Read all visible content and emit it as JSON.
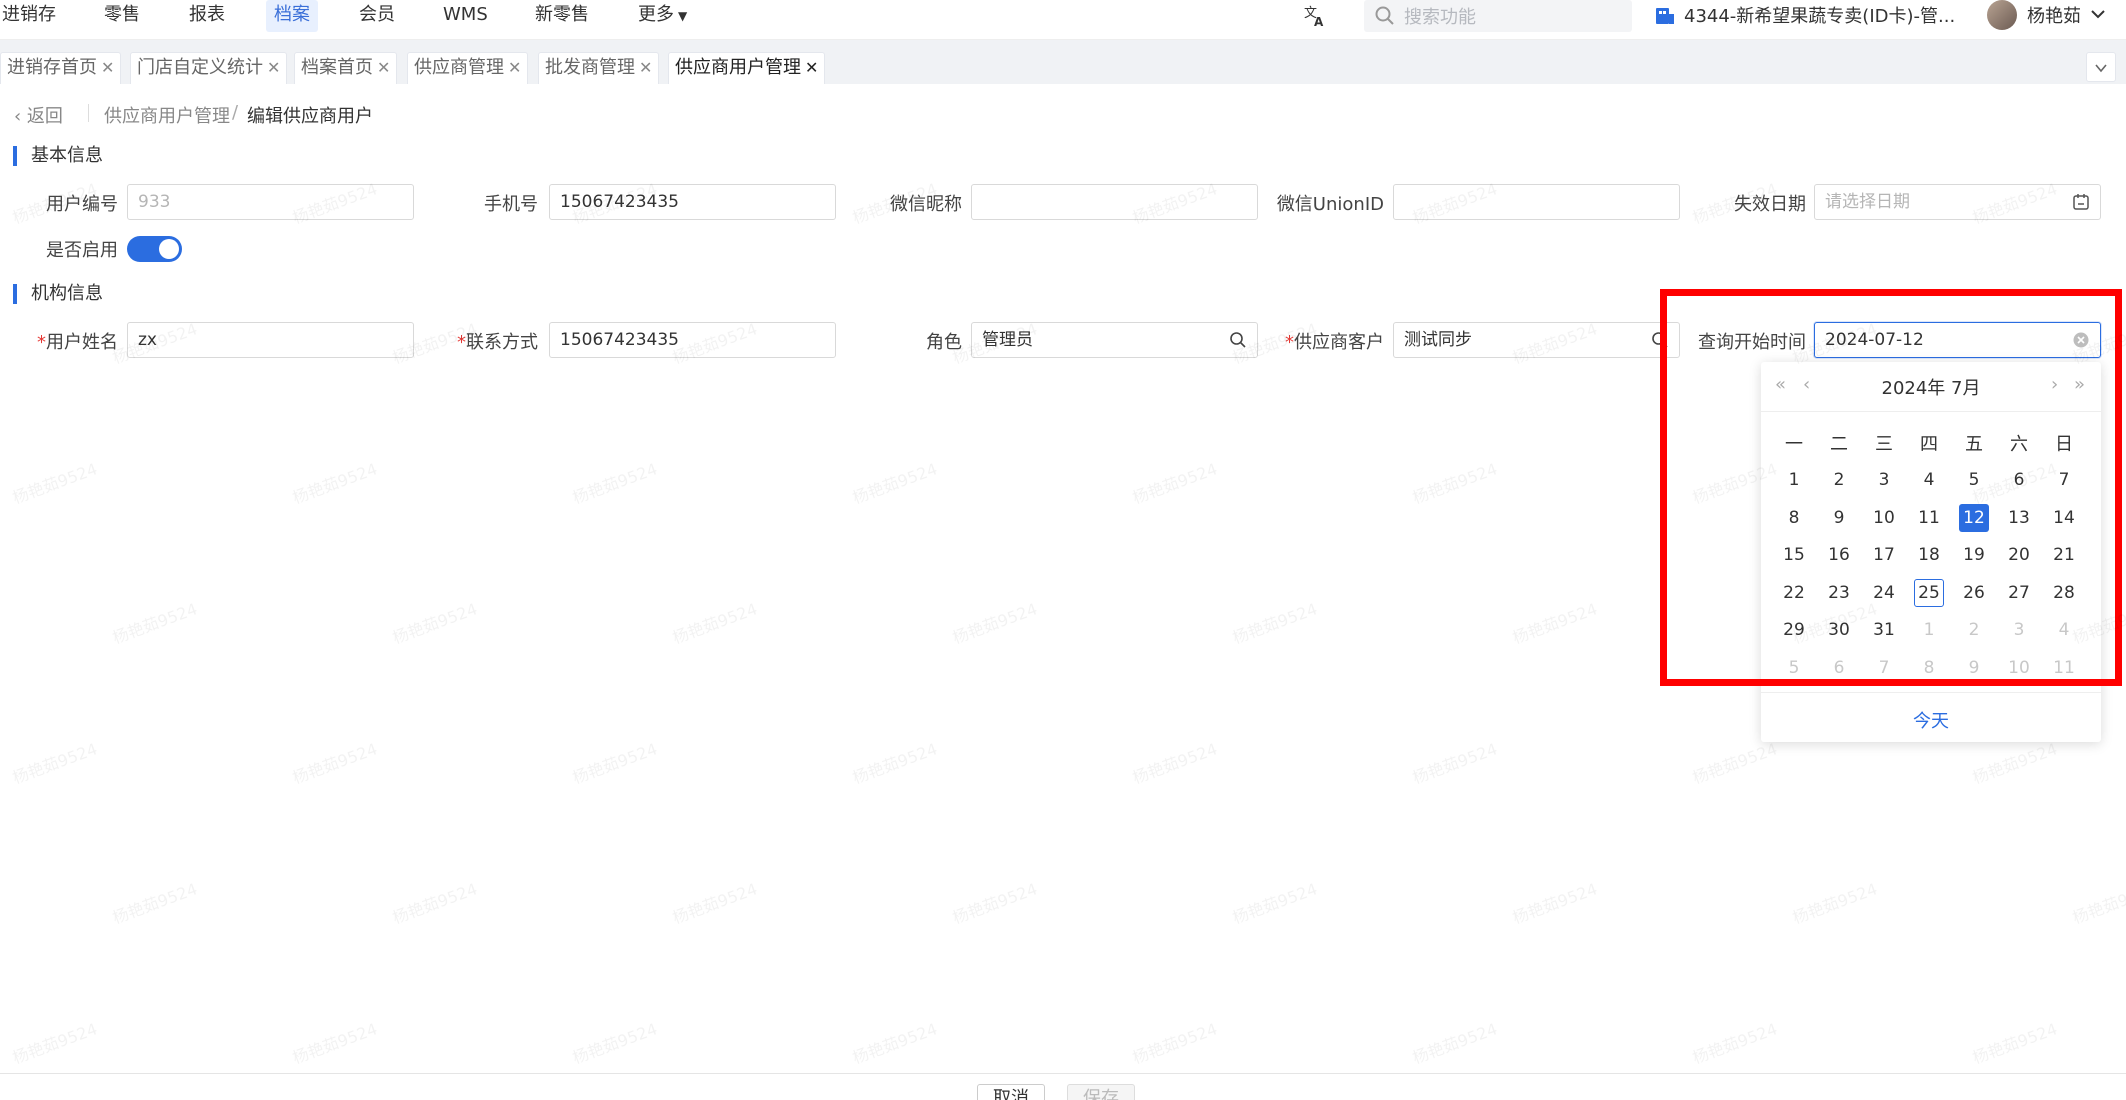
{
  "topnav": {
    "items": [
      {
        "label": "进销存"
      },
      {
        "label": "零售"
      },
      {
        "label": "报表"
      },
      {
        "label": "档案"
      },
      {
        "label": "会员"
      },
      {
        "label": "WMS"
      },
      {
        "label": "新零售"
      },
      {
        "label": "更多"
      }
    ],
    "active": "档案",
    "search_placeholder": "搜索功能",
    "store": "4344-新希望果蔬专卖(ID卡)-管...",
    "user": "杨艳茹"
  },
  "tabs": [
    {
      "label": "进销存首页"
    },
    {
      "label": "门店自定义统计"
    },
    {
      "label": "档案首页"
    },
    {
      "label": "供应商管理"
    },
    {
      "label": "批发商管理"
    },
    {
      "label": "供应商用户管理"
    }
  ],
  "breadcrumb": {
    "back": "返回",
    "parent": "供应商用户管理",
    "separator": "/",
    "current": "编辑供应商用户"
  },
  "basic": {
    "title": "基本信息",
    "user_no_label": "用户编号",
    "user_no": "933",
    "phone_label": "手机号",
    "phone": "15067423435",
    "wechat_nick_label": "微信昵称",
    "wechat_nick": "",
    "unionid_label": "微信UnionID",
    "unionid": "",
    "expire_label": "失效日期",
    "expire_placeholder": "请选择日期",
    "enabled_label": "是否启用",
    "enabled": true
  },
  "org": {
    "title": "机构信息",
    "required_mark": "*",
    "username_label": "用户姓名",
    "username": "zx",
    "contact_label": "联系方式",
    "contact": "15067423435",
    "role_label": "角色",
    "role": "管理员",
    "supplier_label": "供应商客户",
    "supplier": "测试同步",
    "query_start_label": "查询开始时间",
    "query_start": "2024-07-12"
  },
  "picker": {
    "title": "2024年 7月",
    "prev_year": "«",
    "prev_month": "‹",
    "next_month": "›",
    "next_year": "»",
    "weekdays": [
      "一",
      "二",
      "三",
      "四",
      "五",
      "六",
      "日"
    ],
    "weeks": [
      [
        "1",
        "2",
        "3",
        "4",
        "5",
        "6",
        "7"
      ],
      [
        "8",
        "9",
        "10",
        "11",
        "12",
        "13",
        "14"
      ],
      [
        "15",
        "16",
        "17",
        "18",
        "19",
        "20",
        "21"
      ],
      [
        "22",
        "23",
        "24",
        "25",
        "26",
        "27",
        "28"
      ],
      [
        "29",
        "30",
        "31",
        "1",
        "2",
        "3",
        "4"
      ],
      [
        "5",
        "6",
        "7",
        "8",
        "9",
        "10",
        "11"
      ]
    ],
    "selected": "12",
    "today": "25",
    "today_link": "今天"
  },
  "footer": {
    "cancel": "取消",
    "save": "保存"
  },
  "watermark": "杨艳茹9524",
  "colors": {
    "accent": "#2b6de0",
    "highlight": "#ff0000",
    "required": "#e53935"
  }
}
